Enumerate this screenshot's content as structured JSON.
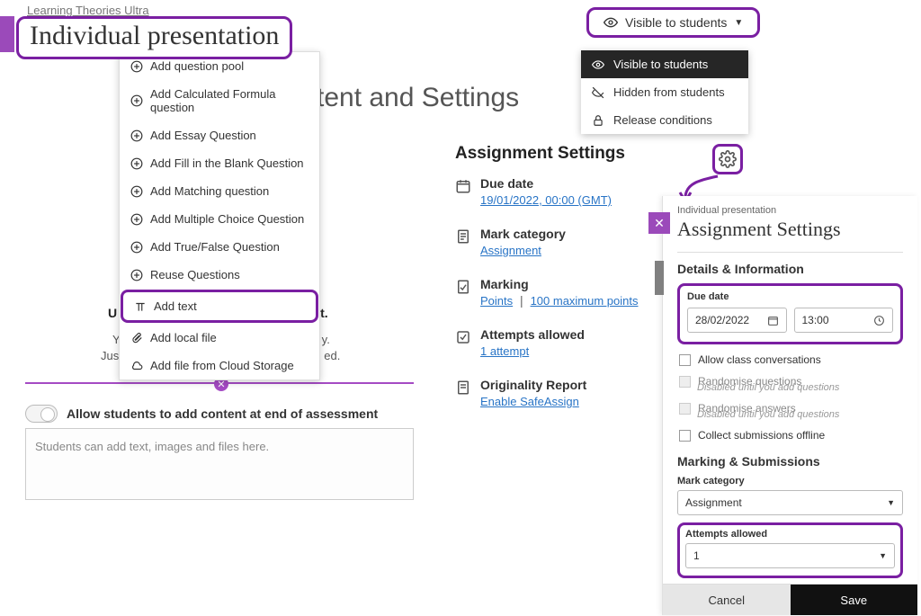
{
  "breadcrumb": "Learning Theories  Ultra",
  "page_title": "Individual presentation",
  "heading_fragment": "tent and Settings",
  "visibility": {
    "trigger": "Visible to students",
    "options": [
      "Visible to students",
      "Hidden from students",
      "Release conditions"
    ]
  },
  "add_menu": {
    "items": [
      "Add question pool",
      "Add Calculated Formula question",
      "Add Essay Question",
      "Add Fill in the Blank Question",
      "Add Matching question",
      "Add Multiple Choice Question",
      "Add True/False Question",
      "Reuse Questions",
      "Add text",
      "Add local file",
      "Add file from Cloud Storage"
    ]
  },
  "behind": {
    "line1_left": "U",
    "line1_right": "t.",
    "line2_left": "Y",
    "line2_right": "y.",
    "line3_left": "Jus",
    "line3_right": "ed."
  },
  "toggle_label": "Allow students to add content at end of assessment",
  "content_placeholder": "Students can add text, images and files here.",
  "settings": {
    "heading": "Assignment Settings",
    "rows": {
      "due": {
        "label": "Due date",
        "value": "19/01/2022, 00:00 (GMT)"
      },
      "mark_cat": {
        "label": "Mark category",
        "value": "Assignment"
      },
      "marking": {
        "label": "Marking",
        "left": "Points",
        "right": "100 maximum points"
      },
      "attempts": {
        "label": "Attempts allowed",
        "value": "1 attempt"
      },
      "orig": {
        "label": "Originality Report",
        "value": "Enable SafeAssign"
      }
    }
  },
  "panel": {
    "breadcrumb": "Individual presentation",
    "title": "Assignment Settings",
    "section_details": "Details & Information",
    "due": {
      "label": "Due date",
      "date": "28/02/2022",
      "time": "13:00"
    },
    "opt_conv": "Allow class conversations",
    "opt_randq": "Randomise questions",
    "opt_randa": "Randomise answers",
    "opt_dis_note": "Disabled until you add questions",
    "opt_offline": "Collect submissions offline",
    "section_marking": "Marking & Submissions",
    "mark_cat": {
      "label": "Mark category",
      "value": "Assignment"
    },
    "attempts": {
      "label": "Attempts allowed",
      "value": "1"
    },
    "cancel": "Cancel",
    "save": "Save"
  }
}
